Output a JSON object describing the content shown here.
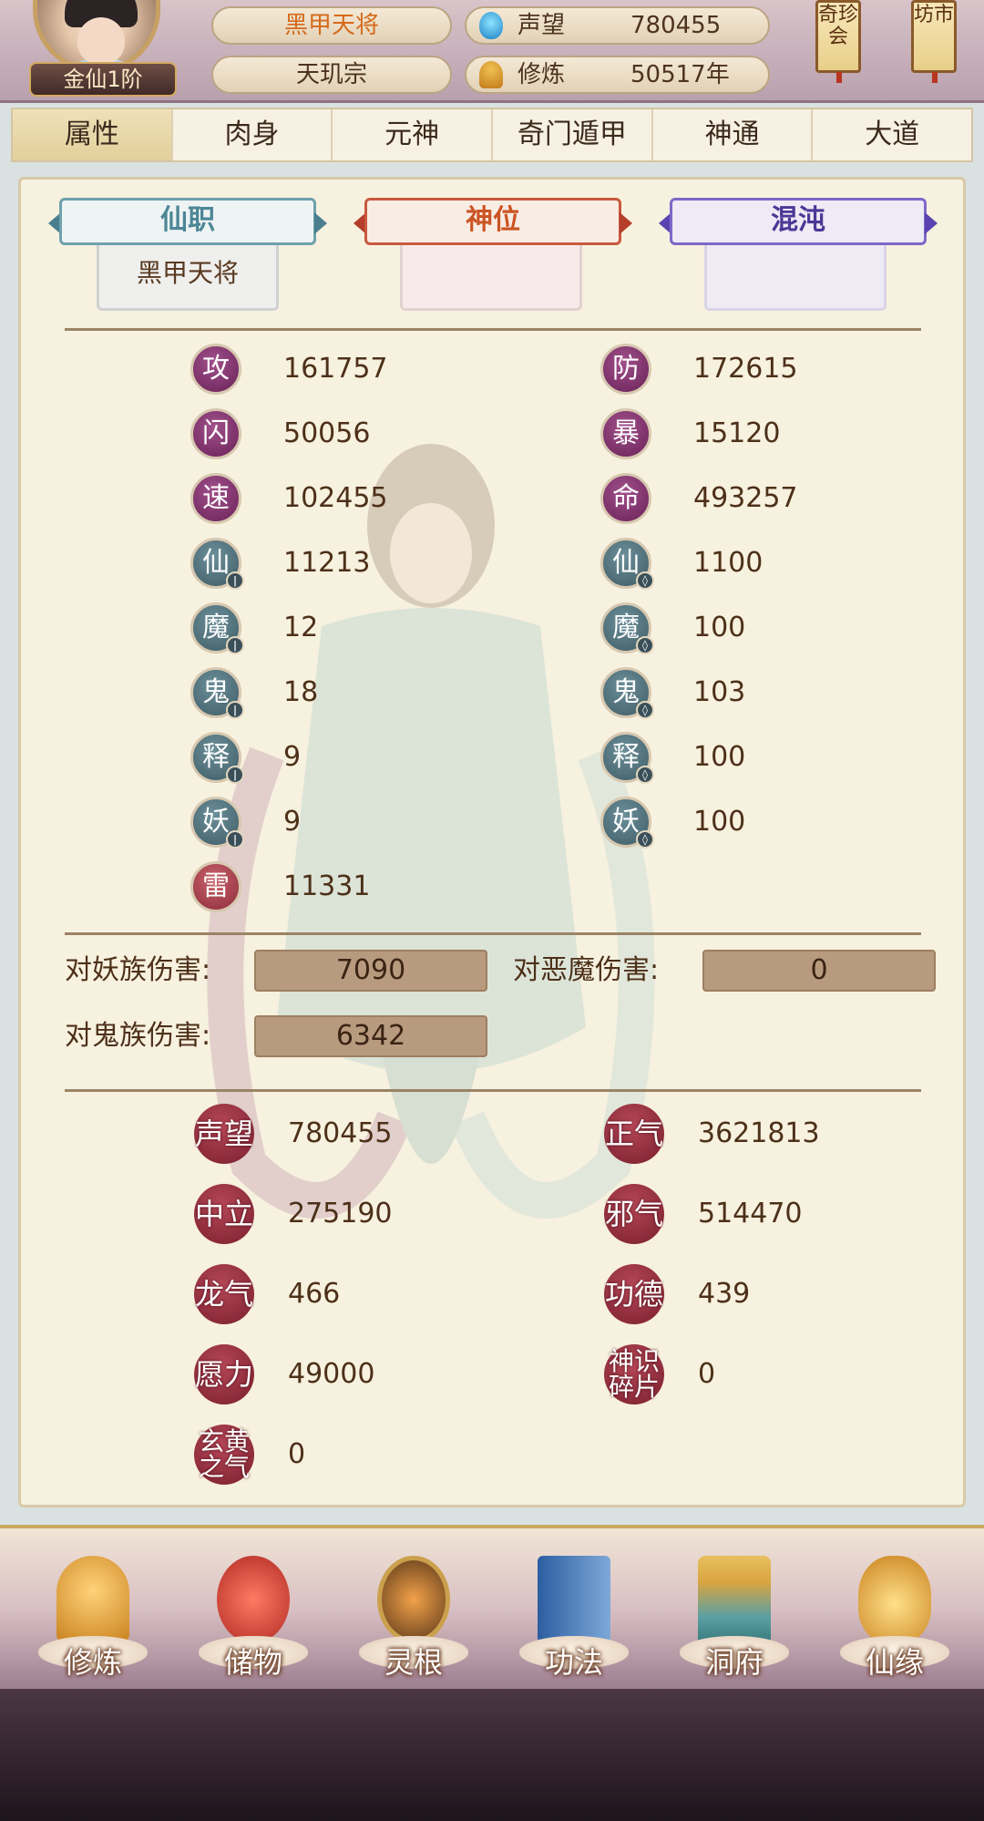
{
  "header": {
    "rank": "金仙1阶",
    "title": "黑甲天将",
    "sect": "天玑宗",
    "reputation_label": "声望",
    "reputation_value": "780455",
    "cultivation_label": "修炼",
    "cultivation_value": "50517年",
    "side_buttons": [
      "奇珍会",
      "坊市"
    ]
  },
  "tabs": [
    {
      "label": "属性",
      "active": true
    },
    {
      "label": "肉身",
      "active": false
    },
    {
      "label": "元神",
      "active": false
    },
    {
      "label": "奇门遁甲",
      "active": false
    },
    {
      "label": "神通",
      "active": false
    },
    {
      "label": "大道",
      "active": false
    }
  ],
  "positions": {
    "xianzhi": {
      "label": "仙职",
      "value": "黑甲天将"
    },
    "shenwei": {
      "label": "神位",
      "value": ""
    },
    "hundun": {
      "label": "混沌",
      "value": ""
    }
  },
  "attributes": {
    "left": [
      {
        "char": "攻",
        "value": "161757",
        "kind": "purple"
      },
      {
        "char": "闪",
        "value": "50056",
        "kind": "purple"
      },
      {
        "char": "速",
        "value": "102455",
        "kind": "purple"
      },
      {
        "char": "仙",
        "value": "11213",
        "kind": "teal-atk"
      },
      {
        "char": "魔",
        "value": "12",
        "kind": "teal-atk"
      },
      {
        "char": "鬼",
        "value": "18",
        "kind": "teal-atk"
      },
      {
        "char": "释",
        "value": "9",
        "kind": "teal-atk"
      },
      {
        "char": "妖",
        "value": "9",
        "kind": "teal-atk"
      },
      {
        "char": "雷",
        "value": "11331",
        "kind": "red"
      }
    ],
    "right": [
      {
        "char": "防",
        "value": "172615",
        "kind": "purple"
      },
      {
        "char": "暴",
        "value": "15120",
        "kind": "purple"
      },
      {
        "char": "命",
        "value": "493257",
        "kind": "purple"
      },
      {
        "char": "仙",
        "value": "1100",
        "kind": "teal-def"
      },
      {
        "char": "魔",
        "value": "100",
        "kind": "teal-def"
      },
      {
        "char": "鬼",
        "value": "103",
        "kind": "teal-def"
      },
      {
        "char": "释",
        "value": "100",
        "kind": "teal-def"
      },
      {
        "char": "妖",
        "value": "100",
        "kind": "teal-def"
      }
    ]
  },
  "damage": {
    "yao_label": "对妖族伤害:",
    "yao_value": "7090",
    "demon_label": "对恶魔伤害:",
    "demon_value": "0",
    "ghost_label": "对鬼族伤害:",
    "ghost_value": "6342"
  },
  "resources": {
    "left": [
      {
        "label": "声望",
        "value": "780455"
      },
      {
        "label": "中立",
        "value": "275190"
      },
      {
        "label": "龙气",
        "value": "466"
      },
      {
        "label": "愿力",
        "value": "49000"
      },
      {
        "label": "玄黄之气",
        "value": "0"
      }
    ],
    "right": [
      {
        "label": "正气",
        "value": "3621813"
      },
      {
        "label": "邪气",
        "value": "514470"
      },
      {
        "label": "功德",
        "value": "439"
      },
      {
        "label": "神识碎片",
        "value": "0"
      }
    ]
  },
  "bottom_nav": [
    "修炼",
    "储物",
    "灵根",
    "功法",
    "洞府",
    "仙缘"
  ],
  "colors": {
    "accent_orange": "#d46a1a",
    "badge_purple": "#6a2158",
    "badge_teal": "#3e5c66",
    "badge_red": "#8c2e3a",
    "panel_bg": "#f7f1df"
  }
}
